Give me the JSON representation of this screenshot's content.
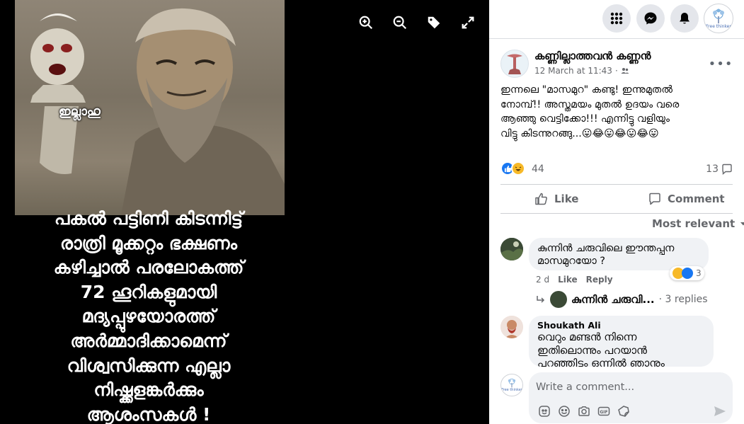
{
  "viewer": {
    "photo_stamp": "ഇല്ലാഹു",
    "caption": "പകൽ പട്ടിണി കിടന്നിട്ട്\nരാത്രി മൂക്കറ്റം ഭക്ഷണം\nകഴിച്ചാൽ പരലോകത്ത്\n72 ഹൂറികളുമായി\nമദ്യപ്പുഴയോരത്ത്\nഅർമ്മാദിക്കാമെന്ന്\nവിശ്വസിക്കുന്ന എല്ലാ\nനിഷ്ക്കളങ്കർക്കും\nആശംസകൾ !",
    "tools": [
      "zoom-in-icon",
      "zoom-out-icon",
      "tag-icon",
      "fullscreen-icon"
    ]
  },
  "topbar": {
    "icons": [
      "menu-grid-icon",
      "messenger-icon",
      "notifications-bell-icon"
    ],
    "profile_label": "Free thinker"
  },
  "post": {
    "author": "കണ്ണില്ലാത്തവൻ കണ്ണൻ",
    "timestamp": "12 March at 11:43",
    "audience_icon": "friends-icon",
    "more_label": "•••",
    "text": "ഇന്നലെ \"മാസമുറ\" കണ്ടു! ഇന്നുമുതൽ\nനോമ്പ്!! അസ്തമയം മുതൽ ഉദയം വരെ\nആഞ്ഞു വെട്ടിക്കോ!!! എന്നിട്ടു വളിയും\nവിട്ടു കിടന്നുറങ്ങു...😛😂😛😂😛😂😛",
    "reaction_count": "44",
    "comment_count": "13",
    "like_label": "Like",
    "comment_label": "Comment",
    "sort_label": "Most relevant"
  },
  "comments": [
    {
      "name": "",
      "text": "കുന്നിൻ ചരുവിലെ ഈന്തപ്പന\nമാസമുറയോ ?",
      "reaction_count": "3",
      "time": "2 d",
      "like_label": "Like",
      "reply_label": "Reply",
      "reply_author": "കുന്നിൻ ചരുവി...",
      "reply_count": "· 3 replies"
    },
    {
      "name": "Shoukath Ali",
      "text": "വെറും മണ്ടൻ നിന്നെ\nഇതിലൊന്നും പറയാൻ\nപറഞ്ഞിട്ടും ഒന്നിൽ ഞാനും"
    }
  ],
  "composer": {
    "placeholder": "Write a comment...",
    "avatar_label": "Free thinker",
    "icons": [
      "sticker-face-icon",
      "emoji-icon",
      "camera-icon",
      "gif-icon",
      "sticker-icon"
    ],
    "send_icon": "send-icon"
  },
  "colors": {
    "facebook_blue": "#1877f2",
    "secondary_text": "#65676b",
    "bubble_bg": "#f0f2f5",
    "reaction_haha": "#f7b928"
  }
}
